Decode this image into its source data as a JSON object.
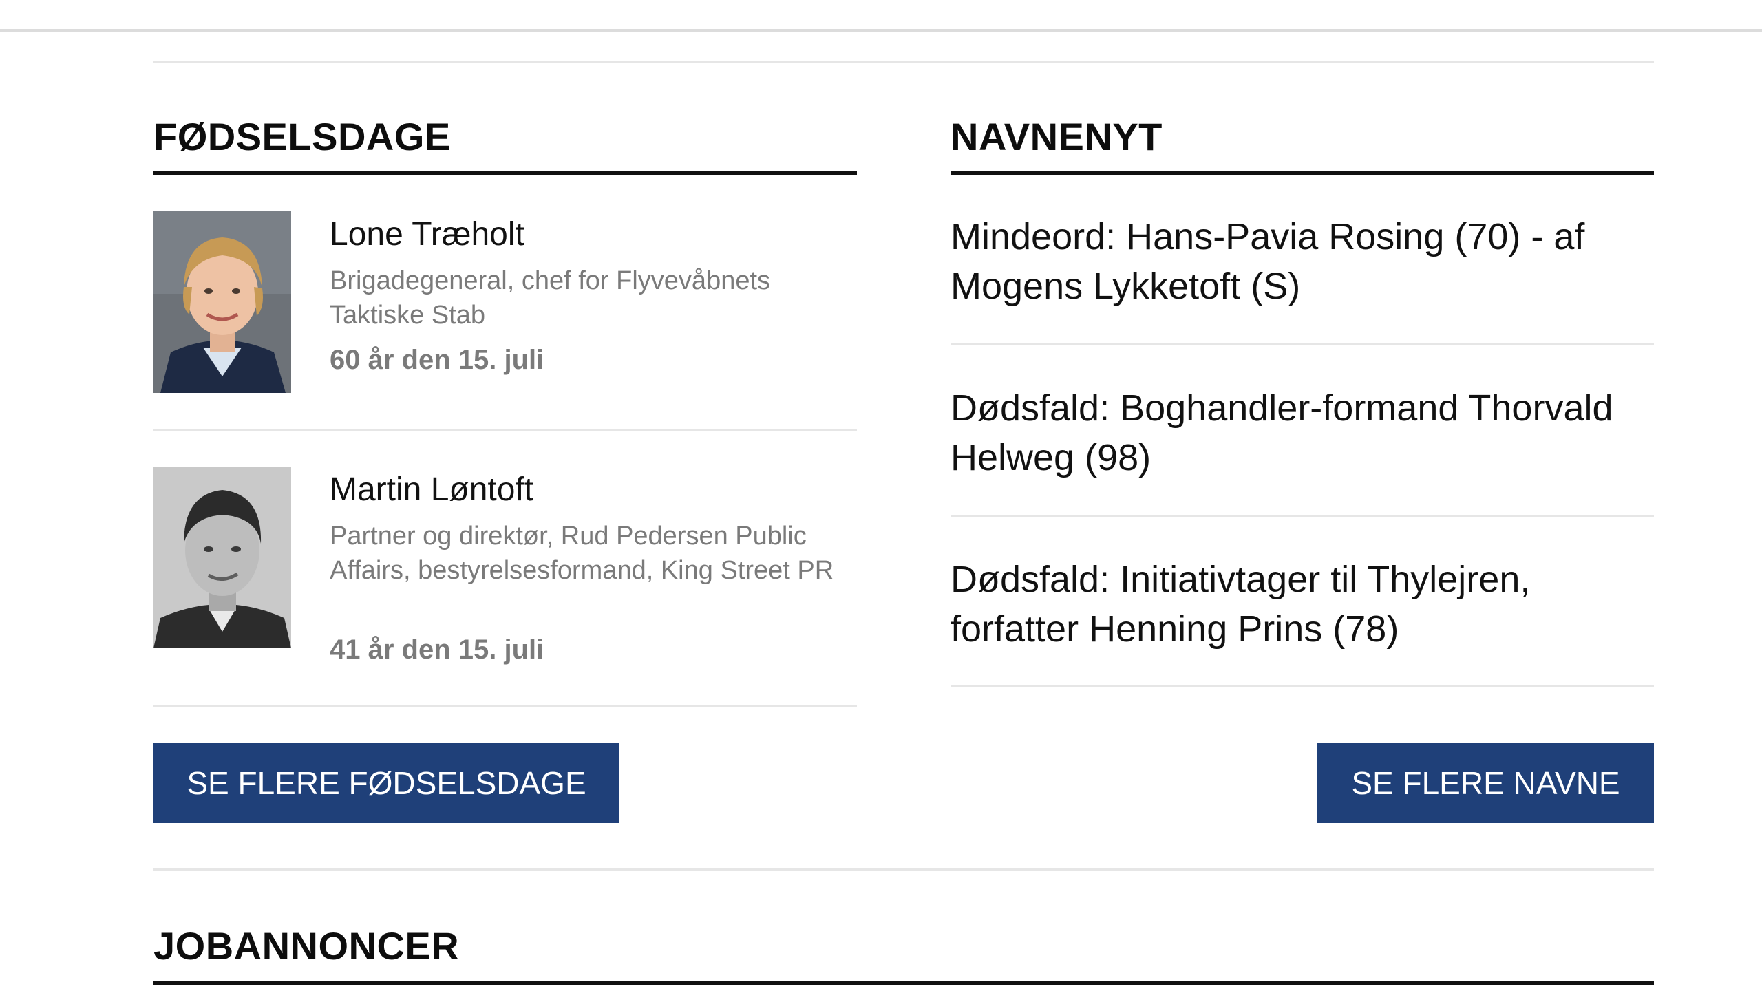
{
  "birthdays": {
    "title": "FØDSELSDAGE",
    "people": [
      {
        "name": "Lone Træholt",
        "role": "Brigadegeneral, chef for Flyvevåbnets Taktiske Stab",
        "age_line": "60 år den 15. juli"
      },
      {
        "name": "Martin Løntoft",
        "role": "Partner og direktør, Rud Pedersen Public Affairs, bestyrelsesformand, King Street PR",
        "age_line": "41 år den 15. juli"
      }
    ],
    "more_button": "SE FLERE FØDSELSDAGE"
  },
  "names_news": {
    "title": "NAVNENYT",
    "items": [
      "Mindeord: Hans-Pavia Rosing (70) - af Mogens Lykketoft (S)",
      "Dødsfald: Boghandler-formand Thorvald Helweg (98)",
      "Dødsfald: Initiativtager til Thylejren, forfatter Henning Prins (78)"
    ],
    "more_button": "SE FLERE NAVNE"
  },
  "jobs": {
    "title": "JOBANNONCER"
  },
  "colors": {
    "button_bg": "#1f4079",
    "button_text": "#ffffff",
    "muted_text": "#7a7a7a",
    "heading_rule": "#111111",
    "divider": "#e6e6e6"
  }
}
